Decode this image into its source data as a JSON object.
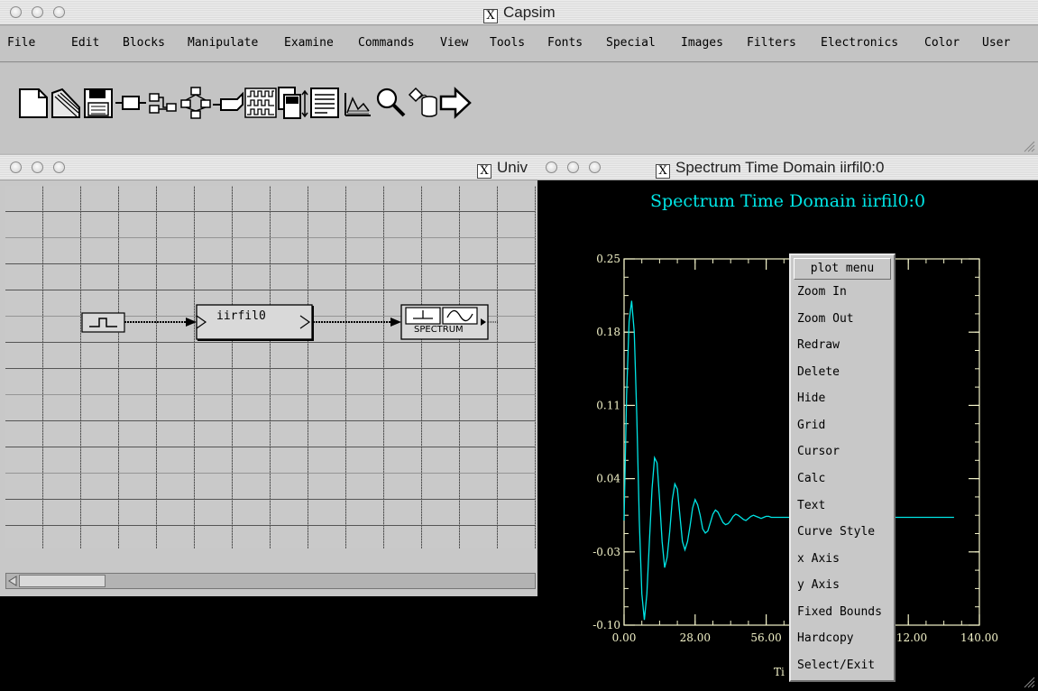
{
  "main_window": {
    "title": "Capsim",
    "menu": [
      "File",
      "Edit",
      "Blocks",
      "Manipulate",
      "Examine",
      "Commands",
      "View",
      "Tools",
      "Fonts",
      "Special",
      "Images",
      "Filters",
      "Electronics",
      "Color",
      "User"
    ],
    "toolbar_icons": [
      "new-file-icon",
      "open-folder-icon",
      "save-disk-icon",
      "block-icon",
      "connect-blocks-icon",
      "hierarchy-icon",
      "probe-icon",
      "waveform-icon",
      "copy-icon",
      "list-icon",
      "plot-icon",
      "magnifier-icon",
      "cylinder-icon",
      "arrow-right-icon"
    ]
  },
  "universe_window": {
    "title": "Univ",
    "blocks": {
      "source_label": "",
      "filter_label": "iirfil0",
      "sink_label": "SPECTRUM"
    }
  },
  "plot_window": {
    "title": "Spectrum Time Domain iirfil0:0",
    "plot_title": "Spectrum Time Domain iirfil0:0",
    "x_axis_label_visible": "Ti",
    "trace_color": "#00e5e5",
    "axis_color": "#f2f2c8"
  },
  "chart_data": {
    "type": "line",
    "title": "Spectrum Time Domain iirfil0:0",
    "xlabel": "Ti",
    "ylabel": "",
    "xlim": [
      0,
      140
    ],
    "ylim": [
      -0.1,
      0.25
    ],
    "x_ticks": [
      "0.00",
      "28.00",
      "56.00",
      "112.00",
      "140.00"
    ],
    "y_ticks": [
      "0.25",
      "0.18",
      "0.11",
      "0.04",
      "-0.03",
      "-0.10"
    ],
    "series": [
      {
        "x": [
          0,
          1,
          2,
          3,
          4,
          5,
          6,
          7,
          8,
          9,
          10,
          11,
          12,
          13,
          14,
          15,
          16,
          17,
          18,
          19,
          20,
          21,
          22,
          23,
          24,
          25,
          26,
          27,
          28,
          29,
          30,
          31,
          32,
          33,
          34,
          35,
          36,
          37,
          38,
          39,
          40,
          41,
          42,
          43,
          44,
          45,
          46,
          47,
          48,
          49,
          50,
          51,
          52,
          53,
          54,
          55,
          56,
          57,
          58,
          59,
          60,
          62,
          64,
          66,
          68,
          70,
          80,
          90,
          100,
          110,
          120,
          130
        ],
        "y": [
          0.0,
          0.12,
          0.19,
          0.21,
          0.18,
          0.1,
          0.0,
          -0.07,
          -0.095,
          -0.07,
          -0.02,
          0.03,
          0.06,
          0.055,
          0.02,
          -0.02,
          -0.045,
          -0.035,
          -0.01,
          0.02,
          0.035,
          0.03,
          0.005,
          -0.02,
          -0.028,
          -0.02,
          -0.005,
          0.012,
          0.02,
          0.015,
          0.005,
          -0.008,
          -0.012,
          -0.01,
          -0.002,
          0.006,
          0.01,
          0.008,
          0.003,
          -0.002,
          -0.004,
          -0.003,
          0.0,
          0.004,
          0.006,
          0.005,
          0.003,
          0.001,
          0.0,
          0.002,
          0.004,
          0.005,
          0.004,
          0.003,
          0.002,
          0.003,
          0.004,
          0.004,
          0.003,
          0.003,
          0.003,
          0.003,
          0.003,
          0.003,
          0.003,
          0.003,
          0.003,
          0.003,
          0.003,
          0.003,
          0.003,
          0.003
        ]
      }
    ]
  },
  "plot_menu": {
    "header": "plot menu",
    "items": [
      "Zoom In",
      "Zoom Out",
      "Redraw",
      "Delete",
      "Hide",
      "Grid",
      "Cursor",
      "Calc",
      "Text",
      "Curve Style",
      "x Axis",
      "y Axis",
      "Fixed Bounds",
      "Hardcopy",
      "Select/Exit"
    ]
  }
}
